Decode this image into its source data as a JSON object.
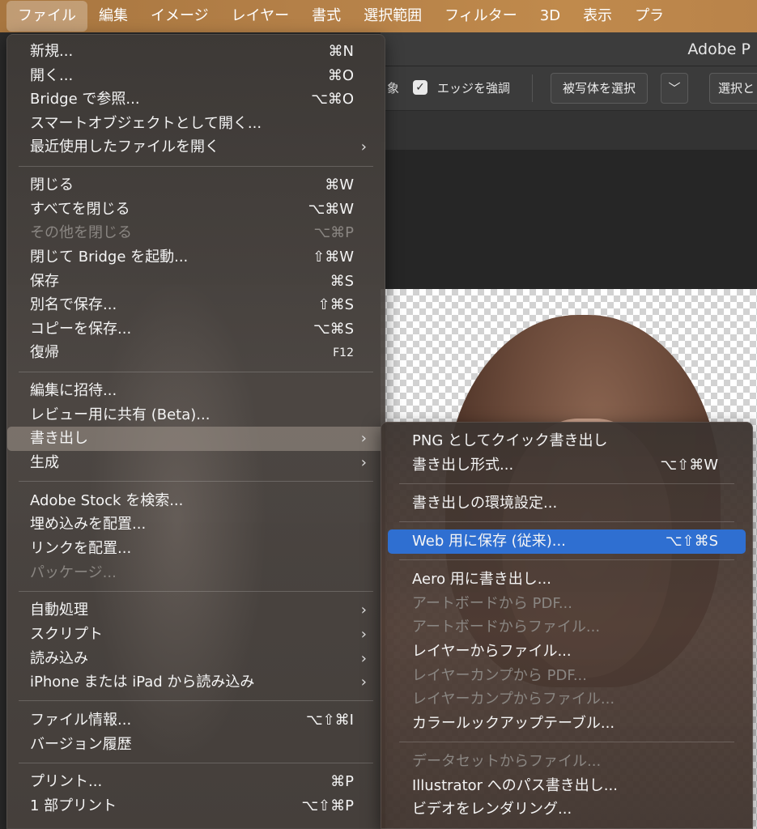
{
  "menubar": {
    "items": [
      "ファイル",
      "編集",
      "イメージ",
      "レイヤー",
      "書式",
      "選択範囲",
      "フィルター",
      "3D",
      "表示",
      "プラ"
    ]
  },
  "app": {
    "title": "Adobe P"
  },
  "options_bar": {
    "partial_label": "象",
    "checkbox_label": "エッジを強調",
    "select_subject_button": "被写体を選択",
    "select_and_mask_partial": "選択と"
  },
  "file_menu": {
    "groups": [
      [
        {
          "label": "新規...",
          "shortcut": "⌘N"
        },
        {
          "label": "開く...",
          "shortcut": "⌘O"
        },
        {
          "label": "Bridge で参照...",
          "shortcut": "⌥⌘O"
        },
        {
          "label": "スマートオブジェクトとして開く..."
        },
        {
          "label": "最近使用したファイルを開く",
          "submenu": true
        }
      ],
      [
        {
          "label": "閉じる",
          "shortcut": "⌘W"
        },
        {
          "label": "すべてを閉じる",
          "shortcut": "⌥⌘W"
        },
        {
          "label": "その他を閉じる",
          "shortcut": "⌥⌘P",
          "disabled": true
        },
        {
          "label": "閉じて Bridge を起動...",
          "shortcut": "⇧⌘W"
        },
        {
          "label": "保存",
          "shortcut": "⌘S"
        },
        {
          "label": "別名で保存...",
          "shortcut": "⇧⌘S"
        },
        {
          "label": "コピーを保存...",
          "shortcut": "⌥⌘S"
        },
        {
          "label": "復帰",
          "shortcut": "F12"
        }
      ],
      [
        {
          "label": "編集に招待..."
        },
        {
          "label": "レビュー用に共有 (Beta)..."
        },
        {
          "label": "書き出し",
          "submenu": true,
          "highlighted": true
        },
        {
          "label": "生成",
          "submenu": true
        }
      ],
      [
        {
          "label": "Adobe Stock を検索..."
        },
        {
          "label": "埋め込みを配置..."
        },
        {
          "label": "リンクを配置..."
        },
        {
          "label": "パッケージ...",
          "disabled": true
        }
      ],
      [
        {
          "label": "自動処理",
          "submenu": true
        },
        {
          "label": "スクリプト",
          "submenu": true
        },
        {
          "label": "読み込み",
          "submenu": true
        },
        {
          "label": "iPhone または iPad から読み込み",
          "submenu": true
        }
      ],
      [
        {
          "label": "ファイル情報...",
          "shortcut": "⌥⇧⌘I"
        },
        {
          "label": "バージョン履歴"
        }
      ],
      [
        {
          "label": "プリント...",
          "shortcut": "⌘P"
        },
        {
          "label": "1 部プリント",
          "shortcut": "⌥⇧⌘P"
        }
      ]
    ]
  },
  "export_submenu": {
    "groups": [
      [
        {
          "label": "PNG としてクイック書き出し"
        },
        {
          "label": "書き出し形式...",
          "shortcut": "⌥⇧⌘W"
        }
      ],
      [
        {
          "label": "書き出しの環境設定..."
        }
      ],
      [
        {
          "label": "Web 用に保存 (従来)...",
          "shortcut": "⌥⇧⌘S",
          "highlighted": true
        }
      ],
      [
        {
          "label": "Aero 用に書き出し..."
        },
        {
          "label": "アートボードから PDF...",
          "disabled": true
        },
        {
          "label": "アートボードからファイル...",
          "disabled": true
        },
        {
          "label": "レイヤーからファイル..."
        },
        {
          "label": "レイヤーカンプから PDF...",
          "disabled": true
        },
        {
          "label": "レイヤーカンプからファイル...",
          "disabled": true
        },
        {
          "label": "カラールックアップテーブル..."
        }
      ],
      [
        {
          "label": "データセットからファイル...",
          "disabled": true
        },
        {
          "label": "Illustrator へのパス書き出し..."
        },
        {
          "label": "ビデオをレンダリング..."
        }
      ]
    ]
  },
  "colors": {
    "highlight_blue": "#2f6fd1",
    "menubar_accent": "#b48048"
  }
}
